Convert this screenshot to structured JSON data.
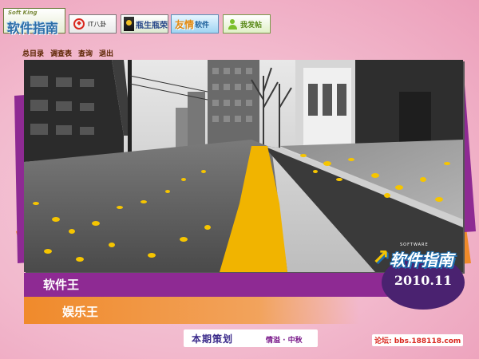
{
  "header": {
    "logo_en": "Soft King",
    "logo_cn": "软件指南",
    "links": [
      {
        "label": "IT八卦",
        "icon": "red-circle-icon"
      },
      {
        "label": "瓶生瓶荣",
        "icon": "bottle-icon"
      },
      {
        "label": "友情",
        "label2": "软件",
        "icon": ""
      },
      {
        "label": "我发帖",
        "icon": "person-icon"
      }
    ]
  },
  "nav": [
    "总目录",
    "调查表",
    "查询",
    "退出"
  ],
  "banner": {
    "logo_sub": "SOFTWARE",
    "logo_text": "软件指南",
    "issue": "2010.11"
  },
  "sections": [
    {
      "label": "软件王",
      "color": "#8e2a93"
    },
    {
      "label": "娱乐王",
      "color": "#f08a2b"
    }
  ],
  "footer": {
    "plan_label": "本期策划",
    "plan_text": "情溢 · 中秋",
    "forum": "论坛: bbs.188118.com"
  }
}
